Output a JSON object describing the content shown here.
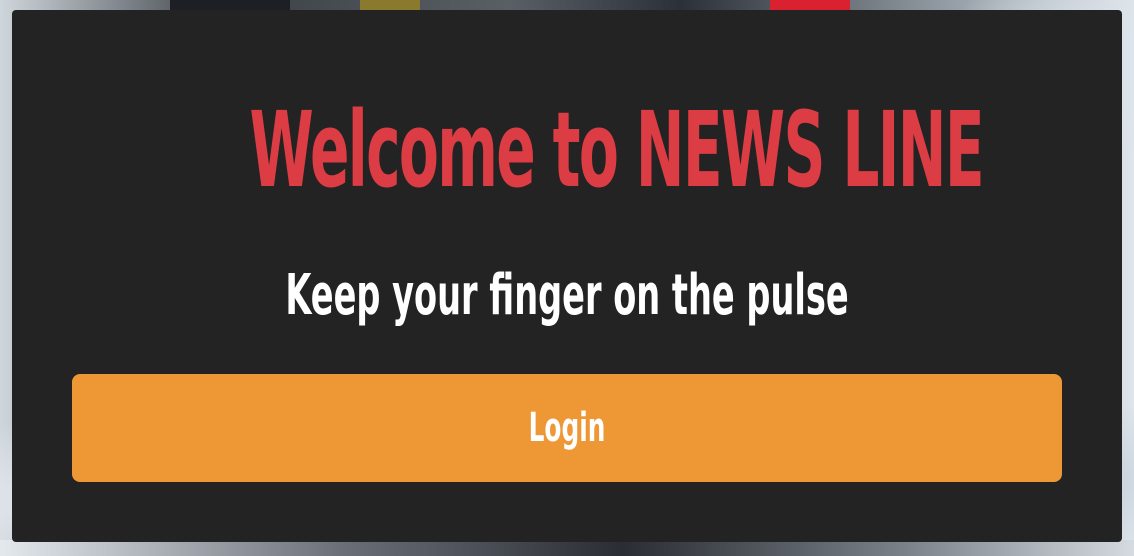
{
  "hero": {
    "title": "Welcome to NEWS LINE",
    "subtitle": "Keep your finger on the pulse"
  },
  "actions": {
    "login_label": "Login"
  },
  "colors": {
    "card_background": "#232323",
    "title": "#dc3c43",
    "subtitle": "#ffffff",
    "login_button": "#ee9735",
    "login_text": "#ffffff"
  }
}
